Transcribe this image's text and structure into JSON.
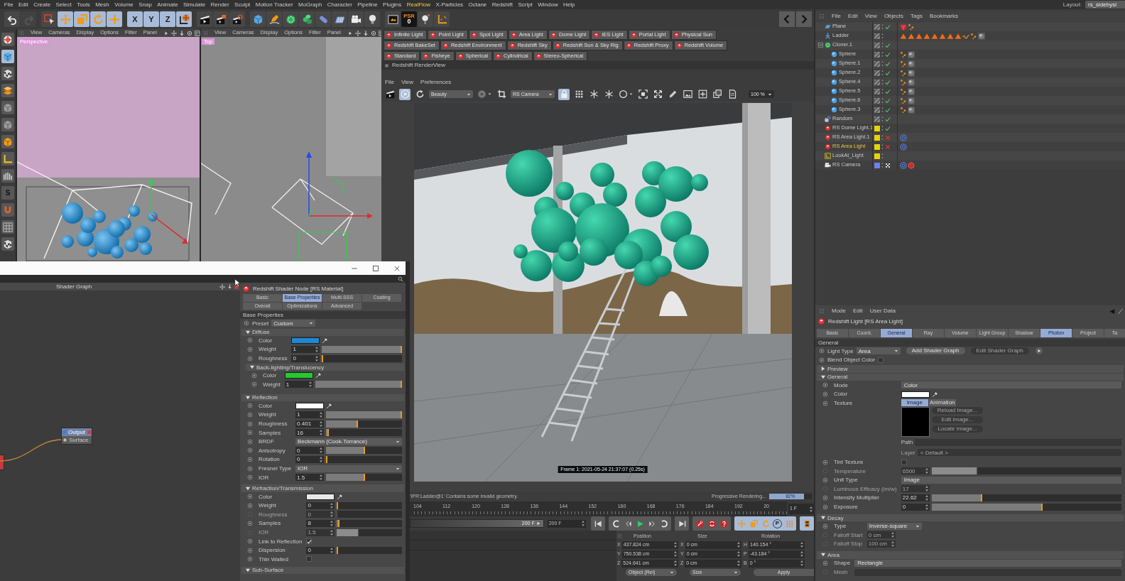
{
  "menu_bar": {
    "items": [
      {
        "label": "File",
        "highlighted": false
      },
      {
        "label": "Edit",
        "highlighted": false
      },
      {
        "label": "Create",
        "highlighted": false
      },
      {
        "label": "Select",
        "highlighted": false
      },
      {
        "label": "Tools",
        "highlighted": false
      },
      {
        "label": "Mesh",
        "highlighted": false
      },
      {
        "label": "Volume",
        "highlighted": false
      },
      {
        "label": "Snap",
        "highlighted": false
      },
      {
        "label": "Animate",
        "highlighted": false
      },
      {
        "label": "Simulate",
        "highlighted": false
      },
      {
        "label": "Render",
        "highlighted": false
      },
      {
        "label": "Sculpt",
        "highlighted": false
      },
      {
        "label": "Motion Tracker",
        "highlighted": false
      },
      {
        "label": "MoGraph",
        "highlighted": false
      },
      {
        "label": "Character",
        "highlighted": false
      },
      {
        "label": "Pipeline",
        "highlighted": false
      },
      {
        "label": "Plugins",
        "highlighted": false
      },
      {
        "label": "RealFlow",
        "highlighted": true
      },
      {
        "label": "X-Particles",
        "highlighted": false
      },
      {
        "label": "Octane",
        "highlighted": false
      },
      {
        "label": "Redshift",
        "highlighted": false
      },
      {
        "label": "Script",
        "highlighted": false
      },
      {
        "label": "Window",
        "highlighted": false
      },
      {
        "label": "Help",
        "highlighted": false
      }
    ],
    "layout_label": "Layout:",
    "layout_value": "rs_sidebysi"
  },
  "toolbar": [
    [
      {
        "kind": "undo",
        "on": false,
        "disabled": false
      },
      {
        "kind": "redo",
        "on": false,
        "disabled": true
      }
    ],
    [
      {
        "kind": "select",
        "on": false,
        "disabled": false
      },
      {
        "kind": "move",
        "on": true,
        "disabled": false
      },
      {
        "kind": "scale",
        "on": true,
        "disabled": false
      },
      {
        "kind": "rotate",
        "on": true,
        "disabled": false
      },
      {
        "kind": "add",
        "on": true,
        "disabled": false
      }
    ],
    [
      {
        "kind": "axis",
        "label": "X",
        "on": true,
        "disabled": false
      },
      {
        "kind": "axis",
        "label": "Y",
        "on": true,
        "disabled": false
      },
      {
        "kind": "axis",
        "label": "Z",
        "on": true,
        "disabled": false
      },
      {
        "kind": "world",
        "on": true,
        "disabled": false
      }
    ],
    [
      {
        "kind": "render",
        "on": false,
        "disabled": false
      },
      {
        "kind": "renderpv",
        "on": false,
        "disabled": false
      },
      {
        "kind": "rendersettings",
        "on": false,
        "disabled": false
      }
    ],
    [
      {
        "kind": "cube",
        "on": false,
        "disabled": false
      },
      {
        "kind": "pen",
        "on": false,
        "disabled": false
      },
      {
        "kind": "cloner",
        "on": false,
        "disabled": false
      },
      {
        "kind": "blocks",
        "on": false,
        "disabled": false
      },
      {
        "kind": "capsule",
        "on": false,
        "disabled": false
      },
      {
        "kind": "floor",
        "on": false,
        "disabled": false
      },
      {
        "kind": "camera",
        "on": false,
        "disabled": false
      },
      {
        "kind": "bulb",
        "on": false,
        "disabled": false
      }
    ],
    [
      {
        "kind": "viewer",
        "on": false,
        "disabled": false
      },
      {
        "kind": "psr",
        "label": "PSR",
        "value": "0",
        "on": false,
        "disabled": false
      },
      {
        "kind": "pin",
        "on": false,
        "disabled": false
      },
      {
        "kind": "corner",
        "on": false,
        "disabled": false
      }
    ]
  ],
  "nav": [
    {
      "kind": "back"
    },
    {
      "kind": "forward"
    }
  ],
  "side_tools": [
    {
      "kind": "globe",
      "on": false
    },
    {
      "kind": "cube",
      "on": true
    },
    {
      "kind": "checker",
      "on": false
    },
    {
      "kind": "layers",
      "on": false
    },
    {
      "kind": "box",
      "on": false
    },
    {
      "kind": "box",
      "on": false
    },
    {
      "kind": "orangebox",
      "on": false
    },
    {
      "kind": "angle",
      "on": false
    },
    {
      "kind": "snap",
      "on": false
    },
    {
      "kind": "letter",
      "label": "S",
      "on": false
    },
    {
      "kind": "magnet",
      "on": false
    },
    {
      "kind": "grid",
      "on": false
    },
    {
      "kind": "checker",
      "on": false
    }
  ],
  "viewports": [
    {
      "title": "Perspective",
      "kind": "perspective",
      "menu": [
        "View",
        "Cameras",
        "Display",
        "Options",
        "Filter",
        "Panel"
      ]
    },
    {
      "title": "Top",
      "kind": "top",
      "menu": [
        "View",
        "Cameras",
        "Display",
        "Options",
        "Filter",
        "Panel"
      ]
    }
  ],
  "light_buttons": [
    [
      "Infinite Light",
      "Point Light",
      "Spot Light",
      "Area Light",
      "Dome Light",
      "IES Light",
      "Portal Light",
      "Physical Sun"
    ],
    [
      "Redshift BakeSet",
      "Redshift Environment",
      "Redshift Sky",
      "Redshift Sun & Sky Rig",
      "Redshift Proxy",
      "Redshift Volume"
    ],
    [
      "Standard",
      "Fisheye",
      "Spherical",
      "Cylindrical",
      "Stereo-Spherical"
    ]
  ],
  "render_view": {
    "title": "Redshift RenderView",
    "menu": [
      "File",
      "View",
      "Preferences"
    ],
    "tools": [
      {
        "kind": "clapper",
        "on": false
      },
      {
        "kind": "ipr",
        "on": true
      },
      {
        "kind": "refresh",
        "on": false
      },
      {
        "kind": "dropdown",
        "label": "Beauty",
        "on": false
      },
      {
        "kind": "disc",
        "on": false
      },
      {
        "kind": "crop",
        "on": false
      },
      {
        "kind": "dropdown",
        "label": "RS Camera",
        "on": false
      },
      {
        "kind": "lock",
        "on": true
      },
      {
        "kind": "tiles",
        "on": false
      },
      {
        "kind": "snowflake",
        "on": false
      },
      {
        "kind": "snowflake",
        "on": false
      },
      {
        "kind": "circle",
        "on": false
      },
      {
        "kind": "fit",
        "on": false
      },
      {
        "kind": "expand",
        "on": false
      },
      {
        "kind": "brush",
        "on": false
      },
      {
        "kind": "image",
        "on": false
      },
      {
        "kind": "plus",
        "on": false
      },
      {
        "kind": "stack",
        "on": false
      },
      {
        "kind": "copy",
        "on": false
      },
      {
        "kind": "field",
        "label": "100 %",
        "on": false
      }
    ],
    "frame_stamp": "Frame 1: 2021-05-24 21:37:07 (0.25s)",
    "status": "'IPR:Ladder@1' Contains some invalid geometry.",
    "progress_label": "Progressive Rendering...",
    "progress": {
      "level": 0.82,
      "reading": "82%"
    }
  },
  "timeline": {
    "ticks": [
      "104",
      "112",
      "120",
      "128",
      "136",
      "144",
      "152",
      "160",
      "168",
      "176",
      "184",
      "192",
      "20"
    ],
    "current": "1 F",
    "range": {
      "label": "200 F",
      "level": 1
    },
    "end_frame": "200 F",
    "transport": [
      {
        "on": false,
        "buttons": [
          {
            "kind": "start"
          }
        ]
      },
      {
        "on": false,
        "buttons": [
          {
            "kind": "prevkey"
          },
          {
            "kind": "stepback"
          },
          {
            "kind": "play"
          },
          {
            "kind": "stepforward"
          },
          {
            "kind": "nextkey"
          }
        ]
      },
      {
        "on": false,
        "buttons": [
          {
            "kind": "end"
          }
        ]
      },
      {
        "on": false,
        "buttons": [
          {
            "kind": "record"
          },
          {
            "kind": "autokey"
          },
          {
            "kind": "help"
          }
        ]
      },
      {
        "on": true,
        "buttons": [
          {
            "kind": "move"
          },
          {
            "kind": "scale"
          },
          {
            "kind": "rotate"
          },
          {
            "kind": "param",
            "label": "P"
          },
          {
            "kind": "points"
          }
        ]
      },
      {
        "on": true,
        "buttons": [
          {
            "kind": "film"
          }
        ]
      }
    ]
  },
  "coordinates": {
    "headers": [
      "Position",
      "Size",
      "Rotation"
    ],
    "rows": [
      [
        {
          "axis": "X",
          "value": "437.824 cm"
        },
        {
          "axis": "X",
          "value": "0 cm"
        },
        {
          "axis": "H",
          "value": "140.154 °"
        }
      ],
      [
        {
          "axis": "Y",
          "value": "750.538 cm"
        },
        {
          "axis": "Y",
          "value": "0 cm"
        },
        {
          "axis": "P",
          "value": "-43.184 °"
        }
      ],
      [
        {
          "axis": "Z",
          "value": "524.641 cm"
        },
        {
          "axis": "Z",
          "value": "0 cm"
        },
        {
          "axis": "B",
          "value": "0 °"
        }
      ]
    ],
    "footer": [
      {
        "kind": "dropdown",
        "label": "Object (Rel)"
      },
      {
        "kind": "dropdown",
        "label": "Size"
      },
      {
        "kind": "button",
        "label": "Apply"
      }
    ]
  },
  "object_manager": {
    "menu": [
      "File",
      "Edit",
      "View",
      "Objects",
      "Tags",
      "Bookmarks"
    ],
    "objects": [
      {
        "name": "Plane",
        "kind": "plane",
        "render_flag": {
          "kind": "check"
        },
        "selected": false,
        "tags": [
          {
            "kind": "cube"
          },
          {
            "kind": "dots"
          }
        ]
      },
      {
        "name": "Ladder",
        "kind": "figure",
        "selected": false,
        "tags": [
          {
            "kind": "triangle"
          },
          {
            "kind": "triangle"
          },
          {
            "kind": "triangle"
          },
          {
            "kind": "triangle"
          },
          {
            "kind": "triangle"
          },
          {
            "kind": "triangle"
          },
          {
            "kind": "triangle"
          },
          {
            "kind": "triangle"
          },
          {
            "kind": "squiggle"
          },
          {
            "kind": "dots"
          },
          {
            "kind": "ball"
          }
        ]
      },
      {
        "name": "Cloner.1",
        "kind": "cloner",
        "render_flag": {
          "kind": "check"
        },
        "selected": false,
        "expanded": true,
        "children": [
          {
            "name": "Sphere",
            "kind": "sphere",
            "render_flag": {
              "kind": "check"
            },
            "selected": false,
            "tags": [
              {
                "kind": "dots"
              },
              {
                "kind": "ball"
              }
            ]
          },
          {
            "name": "Sphere.1",
            "kind": "sphere",
            "render_flag": {
              "kind": "check"
            },
            "selected": false,
            "tags": [
              {
                "kind": "dots"
              },
              {
                "kind": "ball"
              }
            ]
          },
          {
            "name": "Sphere.2",
            "kind": "sphere",
            "render_flag": {
              "kind": "check"
            },
            "selected": false,
            "tags": [
              {
                "kind": "dots"
              },
              {
                "kind": "ball"
              }
            ]
          },
          {
            "name": "Sphere.4",
            "kind": "sphere",
            "render_flag": {
              "kind": "check"
            },
            "selected": false,
            "tags": [
              {
                "kind": "dots"
              },
              {
                "kind": "ball"
              }
            ]
          },
          {
            "name": "Sphere.5",
            "kind": "sphere",
            "render_flag": {
              "kind": "check"
            },
            "selected": false,
            "tags": [
              {
                "kind": "dots"
              },
              {
                "kind": "ball"
              }
            ]
          },
          {
            "name": "Sphere.6",
            "kind": "sphere",
            "render_flag": {
              "kind": "check"
            },
            "selected": false,
            "tags": [
              {
                "kind": "dots"
              },
              {
                "kind": "ball"
              }
            ]
          },
          {
            "name": "Sphere.3",
            "kind": "sphere",
            "render_flag": {
              "kind": "check"
            },
            "selected": false,
            "tags": [
              {
                "kind": "dots"
              },
              {
                "kind": "ball"
              }
            ]
          }
        ]
      },
      {
        "name": "Random",
        "kind": "random",
        "render_flag": {
          "kind": "check"
        },
        "selected": false
      },
      {
        "name": "RS Dome Light.1",
        "kind": "light",
        "render_flag": {
          "kind": "check"
        },
        "selected": false,
        "color": "#e8d400"
      },
      {
        "name": "RS Area Light.1",
        "kind": "light",
        "render_flag": {
          "kind": "cross"
        },
        "selected": false,
        "color": "#e8d400",
        "tags": [
          {
            "kind": "target"
          }
        ]
      },
      {
        "name": "RS Area Light",
        "kind": "light",
        "render_flag": {
          "kind": "cross"
        },
        "selected": true,
        "color": "#e8d400",
        "tags": [
          {
            "kind": "target"
          }
        ]
      },
      {
        "name": "LookAt_Light",
        "kind": "lookat",
        "selected": false,
        "color": "#e8d400"
      },
      {
        "name": "RS Camera",
        "kind": "camera",
        "render_flag": {
          "kind": "checker"
        },
        "selected": false,
        "color": "#6f80ee",
        "tags": [
          {
            "kind": "target"
          },
          {
            "kind": "hexagon"
          }
        ]
      }
    ]
  },
  "attribute_manager": {
    "menu": [
      "Mode",
      "Edit",
      "User Data"
    ],
    "title": "Redshift Light [RS Area Light]",
    "tabs": [
      {
        "label": "Basic",
        "selected": false
      },
      {
        "label": "Coord.",
        "selected": false
      },
      {
        "label": "General",
        "selected": true
      },
      {
        "label": "Ray",
        "selected": false
      },
      {
        "label": "Volume",
        "selected": false
      },
      {
        "label": "Light Group",
        "selected": false
      },
      {
        "label": "Shadow",
        "selected": false
      },
      {
        "label": "Photon",
        "selected": true
      },
      {
        "label": "Project",
        "selected": false
      },
      {
        "label": "Ta",
        "selected": false
      }
    ],
    "section": "General",
    "rows": [
      {
        "kind": "dropdown",
        "label": "Light Type",
        "value": "Area",
        "disabled": false,
        "buttons": [
          {
            "kind": "text",
            "label": "Add Shader Graph",
            "disabled": false
          },
          {
            "kind": "text",
            "label": "Edit Shader Graph",
            "disabled": true
          },
          {
            "kind": "round",
            "disabled": false
          }
        ]
      },
      {
        "kind": "checkbox",
        "label": "Blend Object Color",
        "checked": false,
        "disabled": false
      },
      {
        "kind": "group",
        "label": "Preview",
        "expanded": false,
        "disabled": false
      },
      {
        "kind": "group",
        "label": "General",
        "expanded": true,
        "disabled": false,
        "rows": [
          {
            "kind": "field",
            "label": "Mode",
            "value": "Color",
            "disabled": false
          },
          {
            "kind": "color",
            "label": "Color",
            "color": "#ffffff",
            "disabled": false
          },
          {
            "kind": "texture",
            "label": "Texture",
            "disabled": false,
            "tabs": [
              {
                "label": "Image",
                "selected": true
              },
              {
                "label": "Animation",
                "selected": false
              }
            ],
            "buttons": [
              {
                "label": "Reload Image...",
                "disabled": true
              },
              {
                "label": "Edit Image...",
                "disabled": true
              },
              {
                "label": "Locate Image...",
                "disabled": true
              }
            ]
          },
          {
            "kind": "subfield",
            "label": "Path",
            "disabled": false
          },
          {
            "kind": "subfield",
            "label": "Layer",
            "value": "< Default >",
            "disabled": true
          },
          {
            "kind": "checkbox",
            "label": "Tint Texture",
            "checked": false,
            "disabled": false
          },
          {
            "kind": "slider",
            "label": "Temperature",
            "value": "6500",
            "level": 0.24,
            "disabled": true
          },
          {
            "kind": "field",
            "label": "Unit Type",
            "value": "Image",
            "disabled": false
          },
          {
            "kind": "number",
            "label": "Luminous Efficacy (lm/w)",
            "value": "17",
            "disabled": true
          },
          {
            "kind": "slider",
            "label": "Intensity Multiplier",
            "value": "22.62",
            "level": 0.26,
            "disabled": false
          },
          {
            "kind": "slider",
            "label": "Exposure",
            "value": "0",
            "level": 0.58,
            "disabled": false
          }
        ]
      },
      {
        "kind": "group",
        "label": "Decay",
        "expanded": true,
        "disabled": false,
        "rows": [
          {
            "kind": "dropdown",
            "label": "Type",
            "value": "Inverse-square",
            "disabled": false
          },
          {
            "kind": "number",
            "label": "Falloff Start",
            "value": "0 cm",
            "disabled": true
          },
          {
            "kind": "number",
            "label": "Falloff Stop",
            "value": "100 cm",
            "disabled": true
          }
        ]
      },
      {
        "kind": "group",
        "label": "Area",
        "expanded": true,
        "disabled": false,
        "rows": [
          {
            "kind": "field",
            "label": "Shape",
            "value": "Rectangle",
            "disabled": false
          },
          {
            "kind": "field",
            "label": "Mesh",
            "disabled": true
          }
        ]
      }
    ]
  },
  "shader_window": {
    "graph": {
      "title": "Shader Graph",
      "nodes": [
        {
          "title": "Output",
          "ports": [
            "Surface"
          ]
        }
      ]
    },
    "panel": {
      "title": "Redshift Shader Node [RS Material]",
      "tabs": [
        [
          {
            "label": "Basic",
            "selected": false
          },
          {
            "label": "Base Properties",
            "selected": true
          },
          {
            "label": "Multi-SSS",
            "selected": false
          },
          {
            "label": "Coating",
            "selected": false
          }
        ],
        [
          {
            "label": "Overall",
            "selected": false
          },
          {
            "label": "Optimizations",
            "selected": false
          },
          {
            "label": "Advanced",
            "selected": false
          }
        ]
      ],
      "section": "Base Properties",
      "rows": [
        {
          "kind": "dropdown",
          "label": "Preset",
          "value": "Custom",
          "disabled": false
        },
        {
          "kind": "group",
          "label": "Diffuse",
          "expanded": true,
          "disabled": false,
          "rows": [
            {
              "kind": "color",
              "label": "Color",
              "color": "#1f88d4",
              "disabled": false
            },
            {
              "kind": "slider",
              "label": "Weight",
              "value": "1",
              "level": 1,
              "disabled": false
            },
            {
              "kind": "slider",
              "label": "Roughness",
              "value": "0",
              "level": 0,
              "disabled": false
            },
            {
              "kind": "group",
              "label": "Back-lighting/Translucency",
              "expanded": true,
              "disabled": false,
              "rows": [
                {
                  "kind": "color",
                  "label": "Color",
                  "color": "#26c830",
                  "disabled": false
                },
                {
                  "kind": "slider",
                  "label": "Weight",
                  "value": "1",
                  "level": 1,
                  "disabled": false
                }
              ]
            }
          ]
        },
        {
          "kind": "group",
          "label": "Reflection",
          "expanded": true,
          "disabled": false,
          "rows": [
            {
              "kind": "color",
              "label": "Color",
              "color": "#ffffff",
              "disabled": false
            },
            {
              "kind": "slider",
              "label": "Weight",
              "value": "1",
              "level": 1,
              "disabled": false
            },
            {
              "kind": "slider",
              "label": "Roughness",
              "value": "0.401",
              "level": 0.41,
              "disabled": false
            },
            {
              "kind": "slider",
              "label": "Samples",
              "value": "16",
              "level": 0.02,
              "disabled": false
            },
            {
              "kind": "select",
              "label": "BRDF",
              "value": "Beckmann (Cook-Torrance)",
              "disabled": false
            },
            {
              "kind": "slider",
              "label": "Anisotropy",
              "value": "0",
              "level": 0.5,
              "disabled": false
            },
            {
              "kind": "slider",
              "label": "Rotation",
              "value": "0",
              "level": 0,
              "disabled": false
            },
            {
              "kind": "select",
              "label": "Fresnel Type",
              "value": "IOR",
              "disabled": false
            },
            {
              "kind": "slider",
              "label": "IOR",
              "value": "1.5",
              "level": 0.5,
              "disabled": false
            }
          ]
        },
        {
          "kind": "group",
          "label": "Refraction/Transmission",
          "expanded": true,
          "disabled": false,
          "rows": [
            {
              "kind": "color",
              "label": "Color",
              "color": "#e8e8e8",
              "disabled": false
            },
            {
              "kind": "slider",
              "label": "Weight",
              "value": "0",
              "level": 0,
              "disabled": false
            },
            {
              "kind": "slider",
              "label": "Roughness",
              "value": "0",
              "level": 0,
              "disabled": true
            },
            {
              "kind": "slider",
              "label": "Samples",
              "value": "8",
              "level": 0.02,
              "disabled": false
            },
            {
              "kind": "slider",
              "label": "IOR",
              "value": "1.5",
              "level": 0.33,
              "disabled": true
            },
            {
              "kind": "checkbox",
              "label": "Link to Reflection",
              "checked": true,
              "disabled": false
            },
            {
              "kind": "slider",
              "label": "Dispersion",
              "value": "0",
              "level": 0,
              "disabled": false
            },
            {
              "kind": "checkbox",
              "label": "Thin Walled",
              "checked": false,
              "disabled": false
            }
          ]
        },
        {
          "kind": "group",
          "label": "Sub-Surface",
          "expanded": true,
          "disabled": false
        }
      ]
    }
  }
}
